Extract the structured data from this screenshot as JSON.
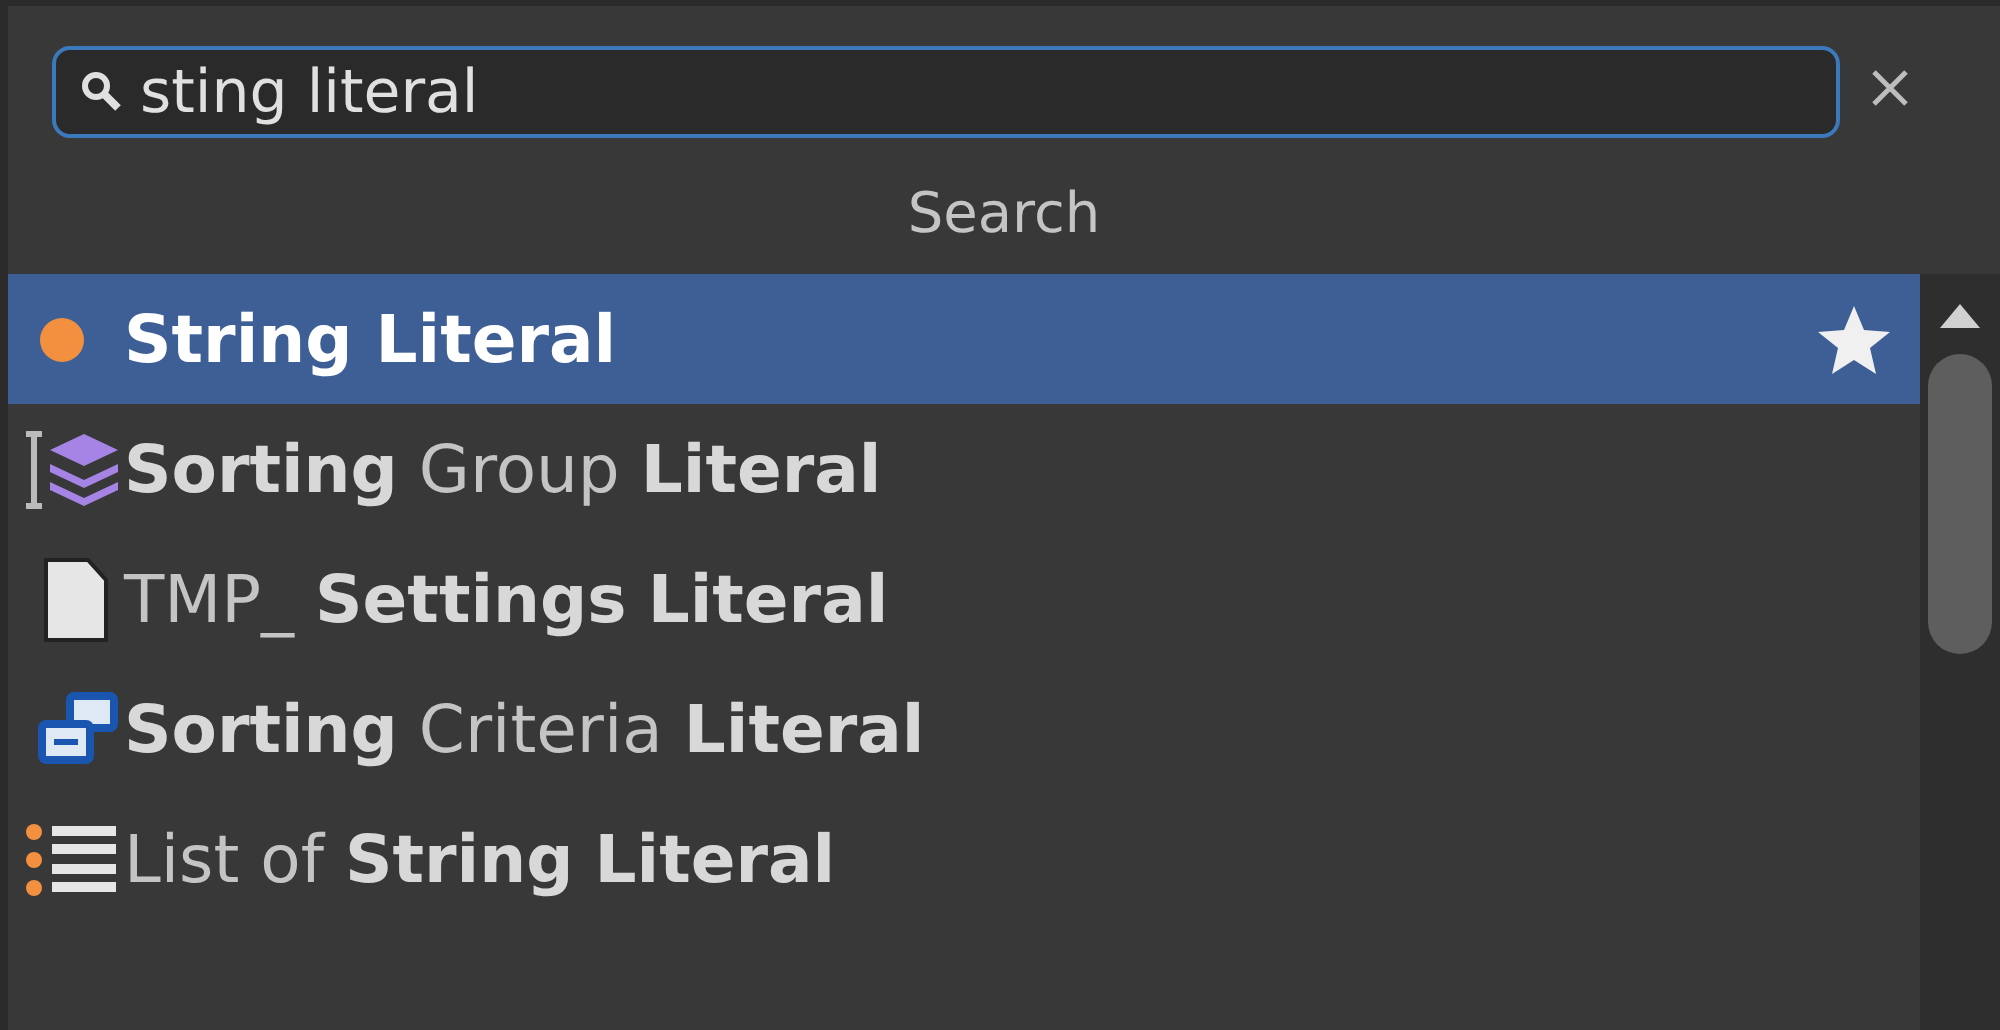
{
  "search": {
    "value": "sting literal"
  },
  "header": "Search",
  "results": [
    {
      "kind": "dot",
      "text": "String Literal",
      "selected": true,
      "favorite": true
    },
    {
      "kind": "layers",
      "text": "**Sorting** Group **Literal**",
      "selected": false,
      "favorite": false
    },
    {
      "kind": "document",
      "text": "TMP_ **Settings** **Literal**",
      "selected": false,
      "favorite": false
    },
    {
      "kind": "windows",
      "text": "**Sorting** Criteria **Literal**",
      "selected": false,
      "favorite": false
    },
    {
      "kind": "list",
      "text": "List of **String** **Literal**",
      "selected": false,
      "favorite": false
    }
  ]
}
